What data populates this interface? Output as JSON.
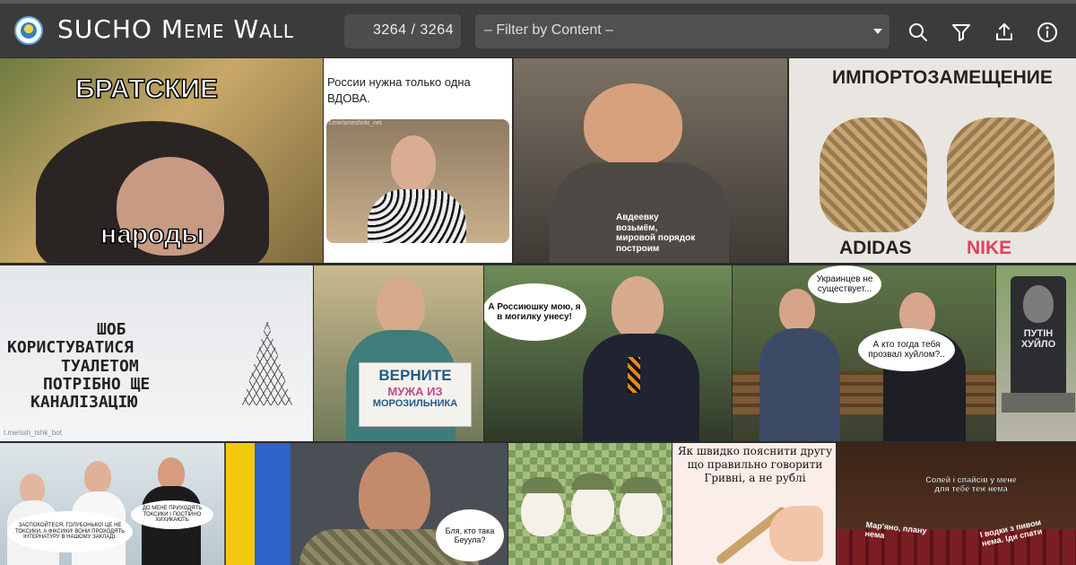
{
  "app": {
    "title": "SUCHO Meme Wall"
  },
  "counter": {
    "text": "3264 / 3264"
  },
  "filter": {
    "selected": "– Filter by Content –"
  },
  "toolbar": {
    "icons": [
      "search-icon",
      "filter-icon",
      "share-icon",
      "info-icon"
    ]
  },
  "tiles": {
    "t1": {
      "top": "БРАТСКИЕ",
      "bottom": "народы"
    },
    "t2": {
      "text": "России нужна только одна ВДОВА.",
      "source": "t.me/smeshnki_net"
    },
    "t3": {
      "line1": "Авдеевку",
      "line2": "возьмём,",
      "line3": "мировой порядок",
      "line4": "построим"
    },
    "t4": {
      "top": "ИМПОРТОЗАМЕЩЕНИЕ",
      "left": "ADIDAS",
      "right": "NIKE"
    },
    "t5": {
      "line1": "ШОБ",
      "line2": "КОРИСТУВАТИСЯ",
      "line3": "ТУАЛЕТОМ",
      "line4": "ПОТРІБНО ЩЕ",
      "line5": "КАНАЛІЗАЦІЮ",
      "source": "t.me/ssh_tshk_bot"
    },
    "t6": {
      "line1": "ВЕРНИТЕ",
      "line2": "МУЖА ИЗ",
      "line3": "МОРОЗИЛЬНИКА"
    },
    "t7": {
      "bubble": "А Россиюшку мою, я в могилку унесу!"
    },
    "t8": {
      "bubble1": "Украинцев не существует...",
      "bubble2": "А кто тогда тебя прозвал хуйлом?.."
    },
    "t9": {
      "plate": "ПУТІН ХУЙЛО"
    },
    "t10": {
      "bubble1": "ЗАСПОКОЙТЕСЯ, ГОЛУБОНЬКО! ЦЕ НЕ ТОКСИКИ, А ФІКСИКИ! ВОНИ ПРОХОДЯТЬ ІНТЕРНАТУРУ В НАШОМУ ЗАКЛАДІ.",
      "bubble2": "ДО МЕНЕ ПРИХОДЯТЬ ТОКСИКИ І ПОСТІЙНО ХИХИКАЮТЬ"
    },
    "t11": {
      "bubble": "Бля, кто така Беуула?"
    },
    "t13": {
      "text": "Як швидко пояснити другу що правильно говорити Гривні, а не рублі"
    },
    "t14": {
      "b1": "Солей і спайсів у мене для тебе теж нема",
      "b2": "Мар'яно, плану нема",
      "b3": "І водки з пивом нема. Іди спати"
    }
  },
  "colors": {
    "topbar": "#3b3b3b",
    "input_bg": "#4d4d4d"
  }
}
